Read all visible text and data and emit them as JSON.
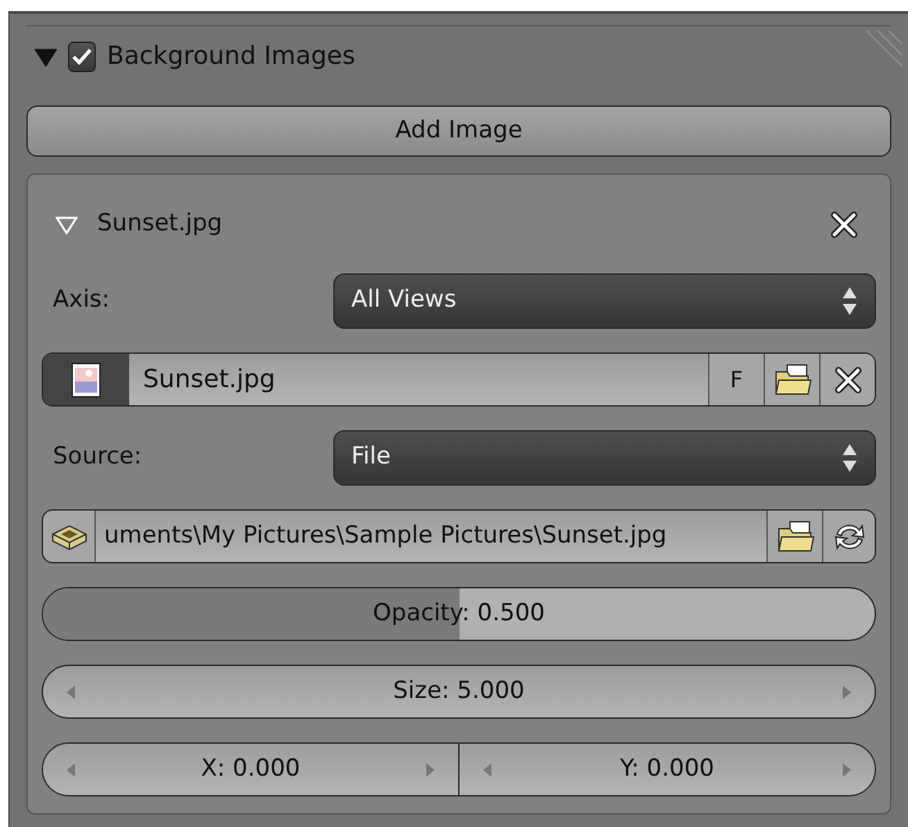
{
  "panel": {
    "title": "Background Images",
    "expanded": true,
    "enabled": true
  },
  "add_button": "Add Image",
  "image": {
    "name": "Sunset.jpg",
    "expanded": true,
    "axis": {
      "label": "Axis:",
      "value": "All Views"
    },
    "image_field": {
      "value": "Sunset.jpg",
      "fake_user": "F"
    },
    "source": {
      "label": "Source:",
      "value": "File"
    },
    "path": "uments\\My Pictures\\Sample Pictures\\Sunset.jpg",
    "opacity": {
      "text": "Opacity: 0.500",
      "level": 0.5
    },
    "size": "Size: 5.000",
    "x": "X: 0.000",
    "y": "Y: 0.000"
  }
}
